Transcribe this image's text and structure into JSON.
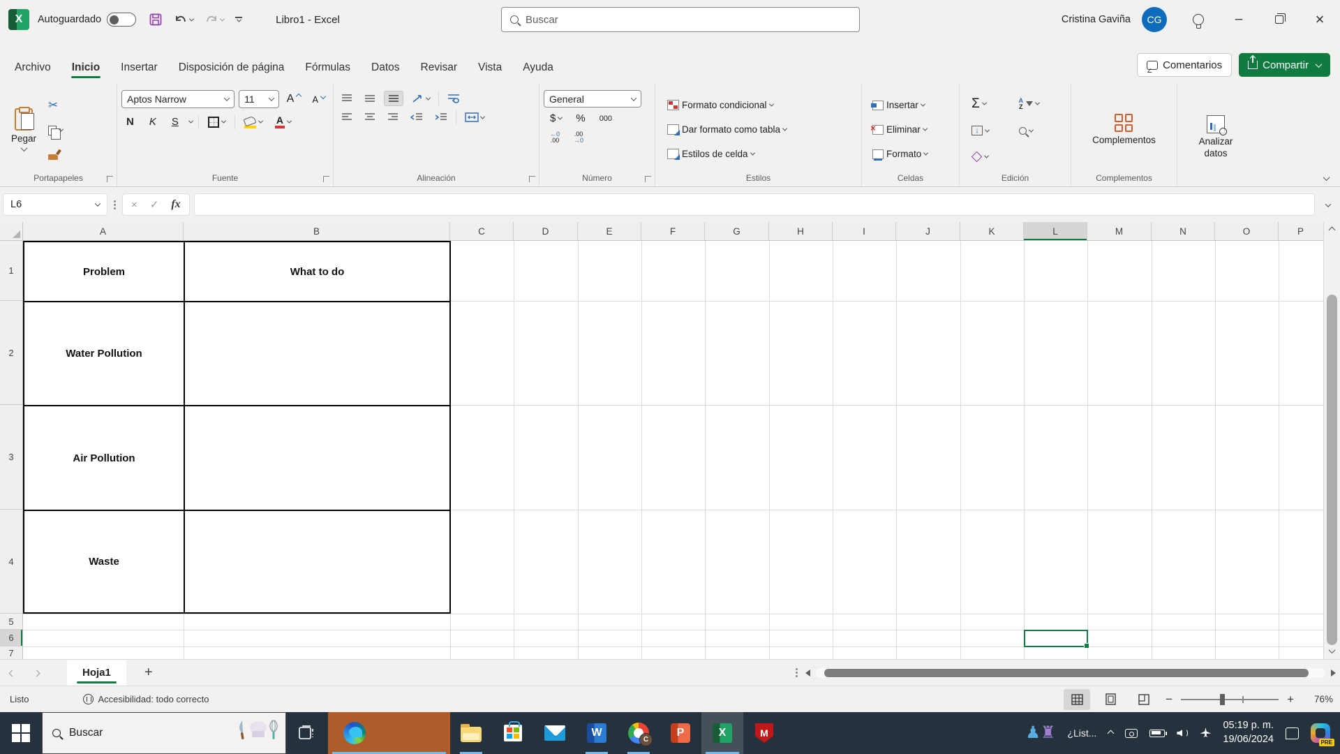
{
  "title_bar": {
    "autosave_label": "Autoguardado",
    "workbook_title": "Libro1  -  Excel",
    "search_placeholder": "Buscar",
    "user_name": "Cristina Gaviña",
    "user_initials": "CG"
  },
  "ribbon_tabs": [
    "Archivo",
    "Inicio",
    "Insertar",
    "Disposición de página",
    "Fórmulas",
    "Datos",
    "Revisar",
    "Vista",
    "Ayuda"
  ],
  "actions": {
    "comments": "Comentarios",
    "share": "Compartir"
  },
  "ribbon": {
    "paste": "Pegar",
    "font_name": "Aptos Narrow",
    "font_size": "11",
    "bold": "N",
    "italic": "K",
    "underline": "S",
    "grow_font": "A",
    "shrink_font": "A",
    "font_color_letter": "A",
    "number_format": "General",
    "currency": "$",
    "percent": "%",
    "thousands": "000",
    "decimals": {
      "inc_top": "←0",
      "inc_bottom": ".00",
      "dec_top": ".00",
      "dec_bottom": "→0"
    },
    "sort_a": "A",
    "sort_z": "Z",
    "conditional": "Formato condicional",
    "format_table": "Dar formato como tabla",
    "cell_styles": "Estilos de celda",
    "insert": "Insertar",
    "delete": "Eliminar",
    "format": "Formato",
    "addins": "Complementos",
    "analyze": "Analizar datos",
    "groups": {
      "clipboard": "Portapapeles",
      "font": "Fuente",
      "alignment": "Alineación",
      "number": "Número",
      "styles": "Estilos",
      "cells": "Celdas",
      "editing": "Edición",
      "addins": "Complementos"
    }
  },
  "formula_bar": {
    "cell_ref": "L6",
    "fx": "fx",
    "content": ""
  },
  "sheet": {
    "columns": [
      "A",
      "B",
      "C",
      "D",
      "E",
      "F",
      "G",
      "H",
      "I",
      "J",
      "K",
      "L",
      "M",
      "N",
      "O",
      "P"
    ],
    "rows": [
      "1",
      "2",
      "3",
      "4",
      "5",
      "6",
      "7"
    ],
    "cells": {
      "A1": "Problem",
      "B1": "What to do",
      "A2": "Water Pollution",
      "A3": "Air Pollution",
      "A4": "Waste"
    },
    "selected_cell": "L6"
  },
  "sheet_bar": {
    "tab": "Hoja1",
    "add": "+"
  },
  "status_bar": {
    "mode": "Listo",
    "accessibility": "Accesibilidad: todo correcto",
    "zoom_out": "−",
    "zoom_in": "+",
    "zoom": "76%"
  },
  "taskbar": {
    "search_placeholder": "Buscar",
    "promo_text": "¿List...",
    "time": "05:19 p. m.",
    "date": "19/06/2024",
    "copilot_badge": "PRE"
  }
}
